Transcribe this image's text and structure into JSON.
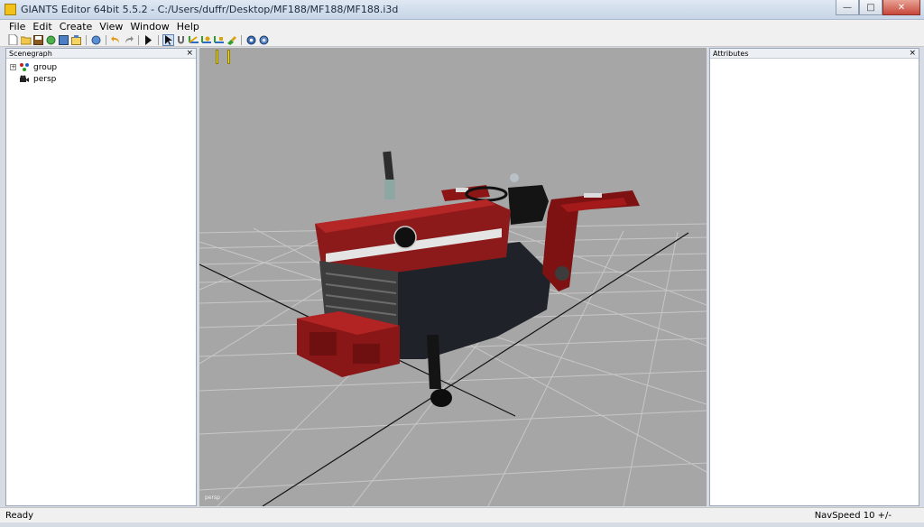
{
  "window": {
    "title": "GIANTS Editor 64bit 5.5.2 - C:/Users/duffr/Desktop/MF188/MF188/MF188.i3d",
    "minimize": "—",
    "maximize": "□",
    "close": "✕"
  },
  "menu": {
    "items": [
      "File",
      "Edit",
      "Create",
      "View",
      "Window",
      "Help"
    ]
  },
  "toolbar": {
    "buttons": [
      "new-icon",
      "open-icon",
      "save-icon",
      "reload-icon",
      "export-icon",
      "import-icon",
      "help-icon",
      "undo-icon",
      "redo-icon",
      "play-icon",
      "select-icon",
      "magnet-icon",
      "move-icon",
      "rotate-icon",
      "scale-icon",
      "paint-icon",
      "gear-icon",
      "settings-icon"
    ]
  },
  "scenegraph": {
    "title": "Scenegraph",
    "close": "×",
    "nodes": [
      {
        "label": "group",
        "expander": "+",
        "icon": "transform-group-icon"
      },
      {
        "label": "persp",
        "expander": "",
        "icon": "camera-icon"
      }
    ]
  },
  "viewport": {
    "camera_label": "persp",
    "background": "#a6a6a6"
  },
  "attributes": {
    "title": "Attributes",
    "close": "×"
  },
  "status": {
    "left": "Ready",
    "right": "NavSpeed 10 +/-"
  }
}
